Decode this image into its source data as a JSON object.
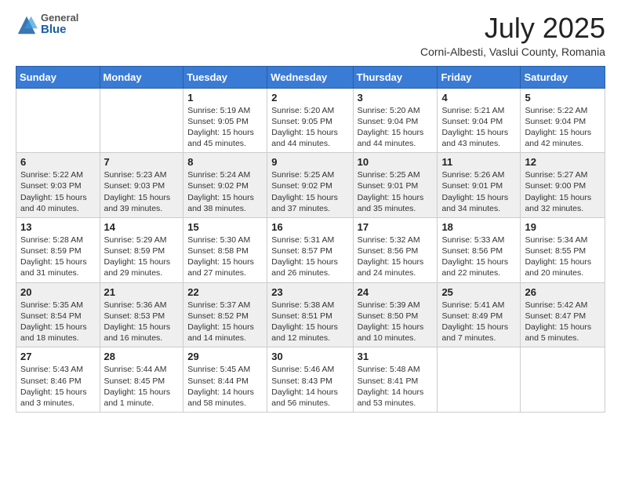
{
  "header": {
    "logo_general": "General",
    "logo_blue": "Blue",
    "month_title": "July 2025",
    "location": "Corni-Albesti, Vaslui County, Romania"
  },
  "days_of_week": [
    "Sunday",
    "Monday",
    "Tuesday",
    "Wednesday",
    "Thursday",
    "Friday",
    "Saturday"
  ],
  "weeks": [
    [
      {
        "day": "",
        "text": ""
      },
      {
        "day": "",
        "text": ""
      },
      {
        "day": "1",
        "text": "Sunrise: 5:19 AM\nSunset: 9:05 PM\nDaylight: 15 hours and 45 minutes."
      },
      {
        "day": "2",
        "text": "Sunrise: 5:20 AM\nSunset: 9:05 PM\nDaylight: 15 hours and 44 minutes."
      },
      {
        "day": "3",
        "text": "Sunrise: 5:20 AM\nSunset: 9:04 PM\nDaylight: 15 hours and 44 minutes."
      },
      {
        "day": "4",
        "text": "Sunrise: 5:21 AM\nSunset: 9:04 PM\nDaylight: 15 hours and 43 minutes."
      },
      {
        "day": "5",
        "text": "Sunrise: 5:22 AM\nSunset: 9:04 PM\nDaylight: 15 hours and 42 minutes."
      }
    ],
    [
      {
        "day": "6",
        "text": "Sunrise: 5:22 AM\nSunset: 9:03 PM\nDaylight: 15 hours and 40 minutes."
      },
      {
        "day": "7",
        "text": "Sunrise: 5:23 AM\nSunset: 9:03 PM\nDaylight: 15 hours and 39 minutes."
      },
      {
        "day": "8",
        "text": "Sunrise: 5:24 AM\nSunset: 9:02 PM\nDaylight: 15 hours and 38 minutes."
      },
      {
        "day": "9",
        "text": "Sunrise: 5:25 AM\nSunset: 9:02 PM\nDaylight: 15 hours and 37 minutes."
      },
      {
        "day": "10",
        "text": "Sunrise: 5:25 AM\nSunset: 9:01 PM\nDaylight: 15 hours and 35 minutes."
      },
      {
        "day": "11",
        "text": "Sunrise: 5:26 AM\nSunset: 9:01 PM\nDaylight: 15 hours and 34 minutes."
      },
      {
        "day": "12",
        "text": "Sunrise: 5:27 AM\nSunset: 9:00 PM\nDaylight: 15 hours and 32 minutes."
      }
    ],
    [
      {
        "day": "13",
        "text": "Sunrise: 5:28 AM\nSunset: 8:59 PM\nDaylight: 15 hours and 31 minutes."
      },
      {
        "day": "14",
        "text": "Sunrise: 5:29 AM\nSunset: 8:59 PM\nDaylight: 15 hours and 29 minutes."
      },
      {
        "day": "15",
        "text": "Sunrise: 5:30 AM\nSunset: 8:58 PM\nDaylight: 15 hours and 27 minutes."
      },
      {
        "day": "16",
        "text": "Sunrise: 5:31 AM\nSunset: 8:57 PM\nDaylight: 15 hours and 26 minutes."
      },
      {
        "day": "17",
        "text": "Sunrise: 5:32 AM\nSunset: 8:56 PM\nDaylight: 15 hours and 24 minutes."
      },
      {
        "day": "18",
        "text": "Sunrise: 5:33 AM\nSunset: 8:56 PM\nDaylight: 15 hours and 22 minutes."
      },
      {
        "day": "19",
        "text": "Sunrise: 5:34 AM\nSunset: 8:55 PM\nDaylight: 15 hours and 20 minutes."
      }
    ],
    [
      {
        "day": "20",
        "text": "Sunrise: 5:35 AM\nSunset: 8:54 PM\nDaylight: 15 hours and 18 minutes."
      },
      {
        "day": "21",
        "text": "Sunrise: 5:36 AM\nSunset: 8:53 PM\nDaylight: 15 hours and 16 minutes."
      },
      {
        "day": "22",
        "text": "Sunrise: 5:37 AM\nSunset: 8:52 PM\nDaylight: 15 hours and 14 minutes."
      },
      {
        "day": "23",
        "text": "Sunrise: 5:38 AM\nSunset: 8:51 PM\nDaylight: 15 hours and 12 minutes."
      },
      {
        "day": "24",
        "text": "Sunrise: 5:39 AM\nSunset: 8:50 PM\nDaylight: 15 hours and 10 minutes."
      },
      {
        "day": "25",
        "text": "Sunrise: 5:41 AM\nSunset: 8:49 PM\nDaylight: 15 hours and 7 minutes."
      },
      {
        "day": "26",
        "text": "Sunrise: 5:42 AM\nSunset: 8:47 PM\nDaylight: 15 hours and 5 minutes."
      }
    ],
    [
      {
        "day": "27",
        "text": "Sunrise: 5:43 AM\nSunset: 8:46 PM\nDaylight: 15 hours and 3 minutes."
      },
      {
        "day": "28",
        "text": "Sunrise: 5:44 AM\nSunset: 8:45 PM\nDaylight: 15 hours and 1 minute."
      },
      {
        "day": "29",
        "text": "Sunrise: 5:45 AM\nSunset: 8:44 PM\nDaylight: 14 hours and 58 minutes."
      },
      {
        "day": "30",
        "text": "Sunrise: 5:46 AM\nSunset: 8:43 PM\nDaylight: 14 hours and 56 minutes."
      },
      {
        "day": "31",
        "text": "Sunrise: 5:48 AM\nSunset: 8:41 PM\nDaylight: 14 hours and 53 minutes."
      },
      {
        "day": "",
        "text": ""
      },
      {
        "day": "",
        "text": ""
      }
    ]
  ]
}
